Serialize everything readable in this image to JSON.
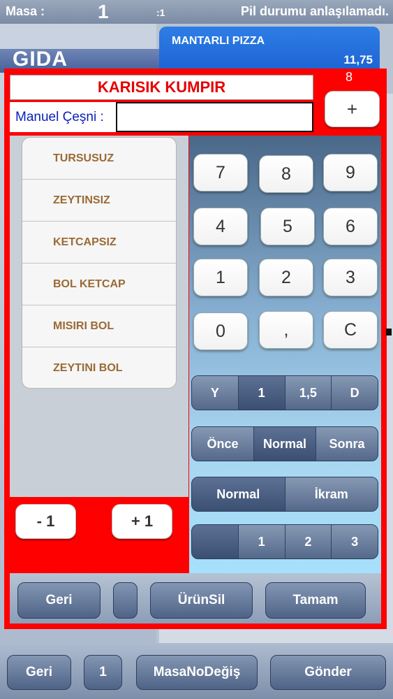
{
  "status": {
    "masa_label": "Masa :",
    "table_number": "1",
    "seat": ":1",
    "battery_text": "Pil durumu anlaşılamadı."
  },
  "background": {
    "category_title": "GIDA",
    "order_item_name": "MANTARLI PIZZA",
    "order_item_price": "11,75"
  },
  "modal": {
    "quantity": "8",
    "product_title": "KARISIK KUMPIR",
    "manual_label": "Manuel Çeşni :",
    "manual_value": "",
    "plus_label": "+",
    "options": [
      "TURSUSUZ",
      "ZEYTINSIZ",
      "KETCAPSIZ",
      "BOL KETCAP",
      "MISIRI BOL",
      "ZEYTINI BOL"
    ],
    "minus_one_label": "- 1",
    "plus_one_label": "+ 1",
    "keypad": [
      "7",
      "8",
      "9",
      "4",
      "5",
      "6",
      "1",
      "2",
      "3",
      "0",
      ",",
      "C"
    ],
    "portion_segments": [
      "Y",
      "1",
      "1,5",
      "D"
    ],
    "timing_segments": [
      "Önce",
      "Normal",
      "Sonra"
    ],
    "type_segments": [
      "Normal",
      "İkram"
    ],
    "course_segments": [
      "",
      "1",
      "2",
      "3"
    ],
    "toolbar": {
      "back_label": "Geri",
      "blank_label": "",
      "delete_label": "ÜrünSil",
      "ok_label": "Tamam"
    }
  },
  "bottom_bar": {
    "back_label": "Geri",
    "number_label": "1",
    "change_table_label": "MasaNoDeğiş",
    "send_label": "Gönder"
  }
}
